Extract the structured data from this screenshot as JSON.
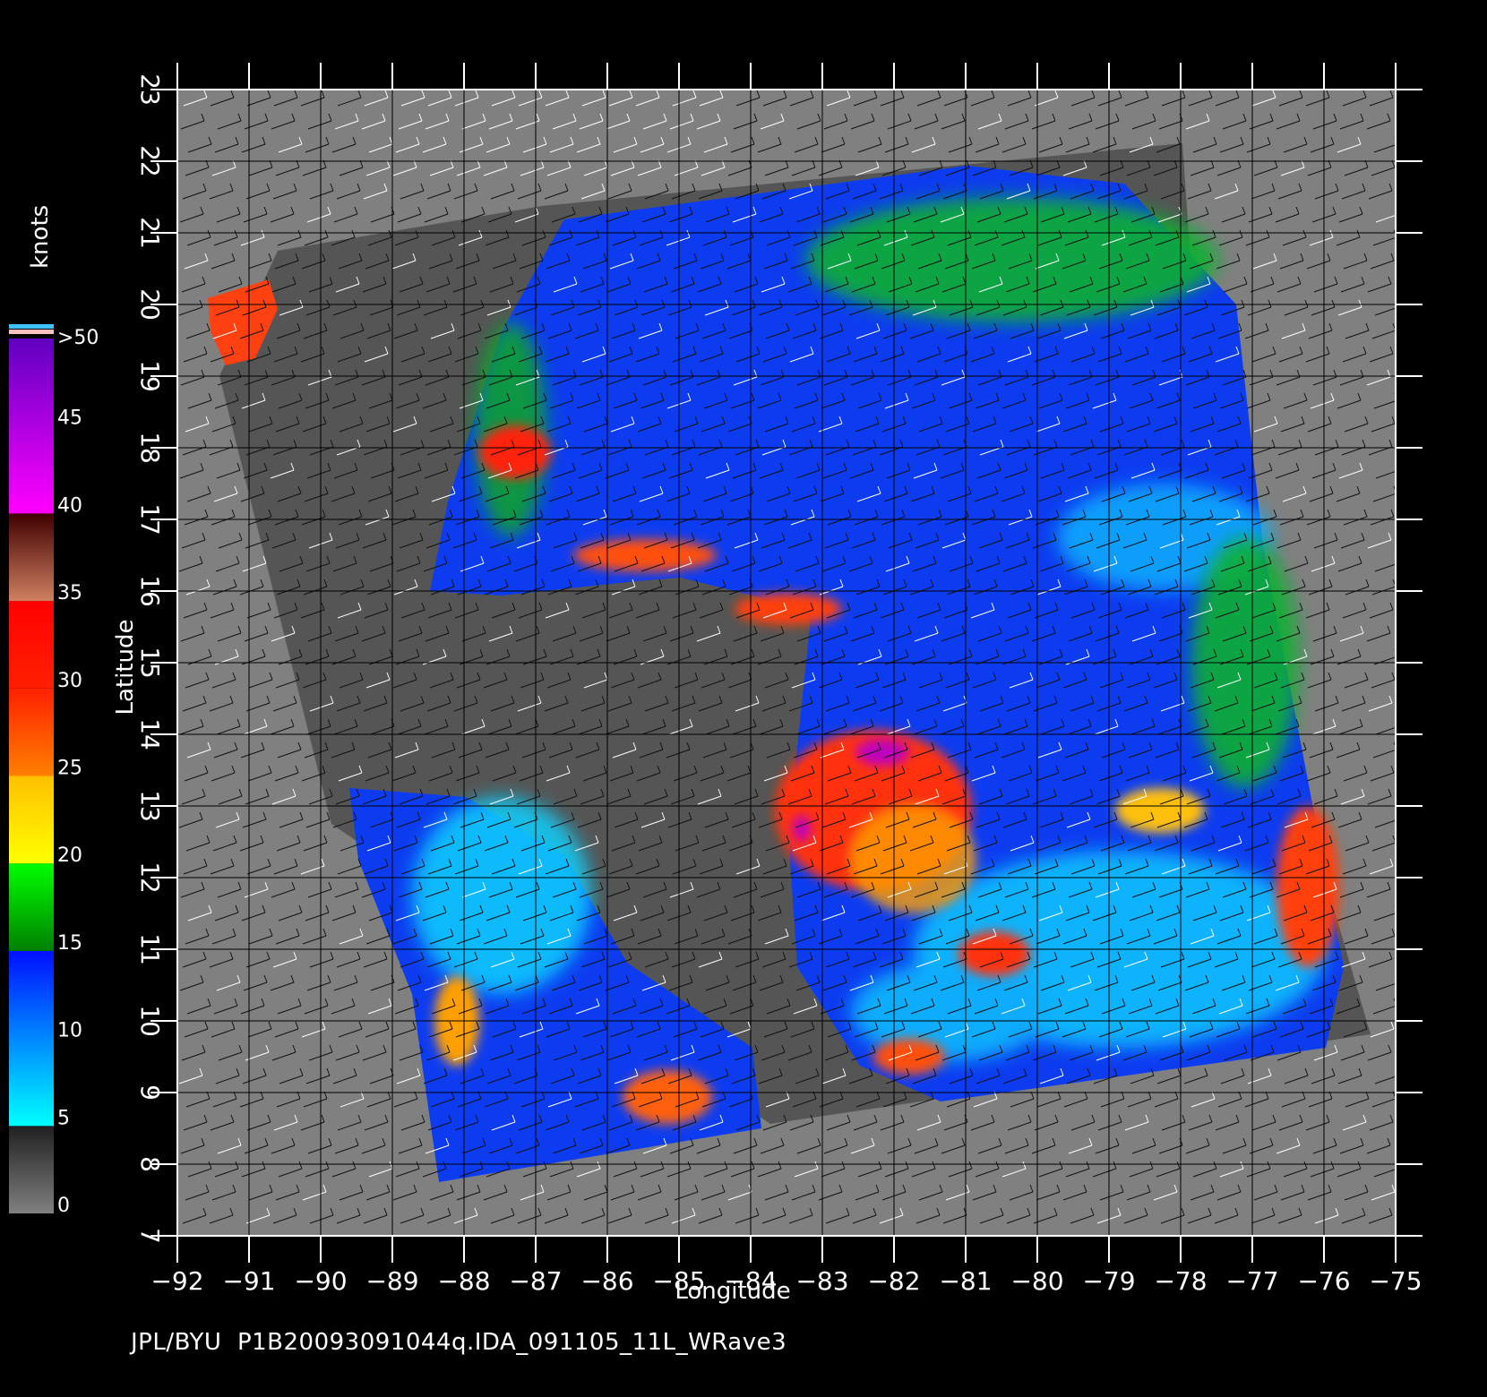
{
  "map": {
    "x_axis": {
      "label": "Longitude",
      "ticks": [
        -92,
        -91,
        -90,
        -89,
        -88,
        -87,
        -86,
        -85,
        -84,
        -83,
        -82,
        -81,
        -80,
        -79,
        -78,
        -77,
        -76,
        -75
      ],
      "range": [
        -92,
        -75
      ]
    },
    "y_axis": {
      "label": "Latitude",
      "ticks": [
        7,
        8,
        9,
        10,
        11,
        12,
        13,
        14,
        15,
        16,
        17,
        18,
        19,
        20,
        21,
        22,
        23
      ],
      "range": [
        7,
        23
      ]
    },
    "grid": true,
    "background_color": "#808080",
    "land_color": "#505050"
  },
  "colorbar": {
    "title": "knots",
    "labels": [
      "0",
      "5",
      "10",
      "15",
      "20",
      "25",
      "30",
      "35",
      "40",
      "45",
      ">50"
    ],
    "stops": [
      {
        "value": 0,
        "color": "#808080"
      },
      {
        "value": 5,
        "color": "#202020"
      },
      {
        "value": 5,
        "color": "#00ffff"
      },
      {
        "value": 15,
        "color": "#0010ff"
      },
      {
        "value": 15,
        "color": "#008000"
      },
      {
        "value": 20,
        "color": "#00ff00"
      },
      {
        "value": 20,
        "color": "#ffff00"
      },
      {
        "value": 25,
        "color": "#ffc000"
      },
      {
        "value": 25,
        "color": "#ff8000"
      },
      {
        "value": 30,
        "color": "#ff2000"
      },
      {
        "value": 35,
        "color": "#ff0000"
      },
      {
        "value": 35,
        "color": "#d08060"
      },
      {
        "value": 40,
        "color": "#400000"
      },
      {
        "value": 40,
        "color": "#ff00ff"
      },
      {
        "value": 50,
        "color": "#6000c0"
      }
    ]
  },
  "footer": {
    "text": "JPL/BYU  P1B20093091044q.IDA_091105_11L_WRave3"
  }
}
